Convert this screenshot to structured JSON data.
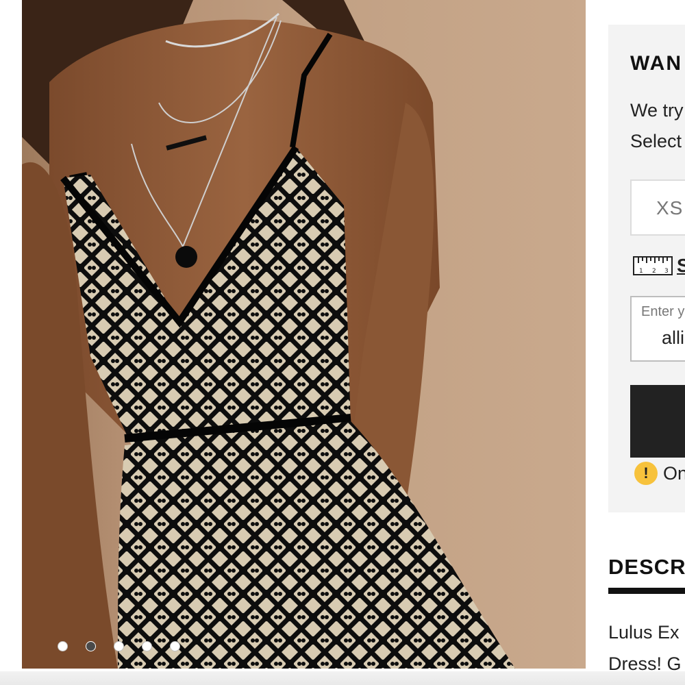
{
  "gallery": {
    "image_alt": "Model wearing black lace dress",
    "dots": [
      {
        "active": false
      },
      {
        "active": true
      },
      {
        "active": false
      },
      {
        "active": false
      },
      {
        "active": false
      }
    ]
  },
  "notify_panel": {
    "title": "WAN",
    "line1": "We try",
    "line2": "Select",
    "size_value": "XS",
    "size_guide_label": "S",
    "email_label": "Enter y",
    "email_value": "alli",
    "notify_button_label": "",
    "note_text": "On"
  },
  "description": {
    "heading": "DESCR",
    "line1": "Lulus Ex",
    "line2": "Dress! G"
  },
  "colors": {
    "panel_bg": "#f3f3f3",
    "button_bg": "#222222",
    "warning": "#f7c23c",
    "backdrop": "#c2a184"
  }
}
